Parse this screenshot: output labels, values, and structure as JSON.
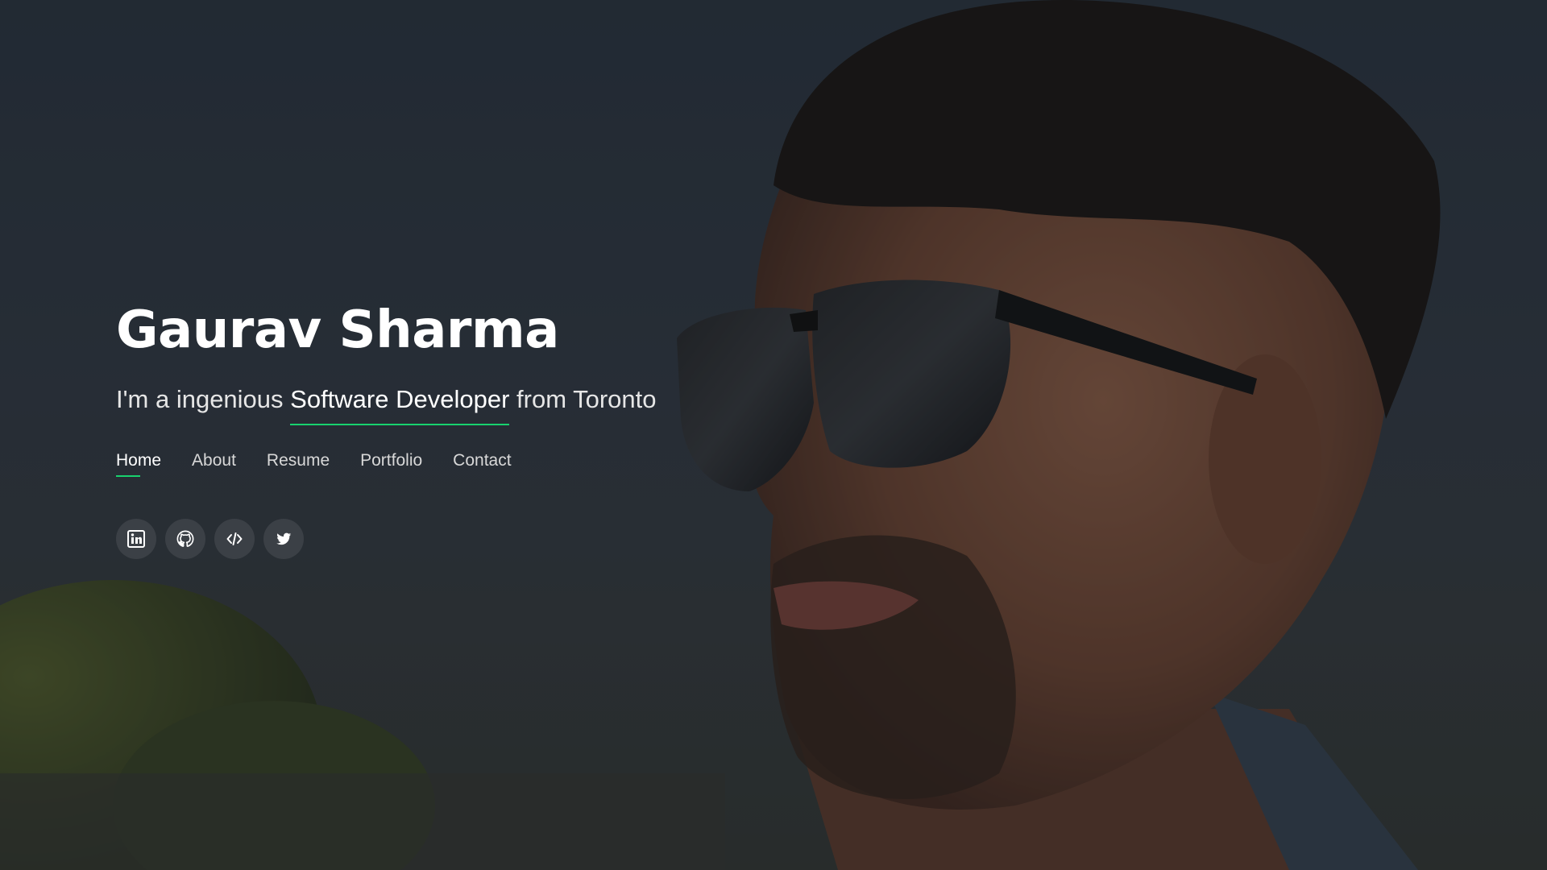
{
  "hero": {
    "name": "Gaurav Sharma",
    "tagline_prefix": "I'm a ingenious ",
    "tagline_role": "Software Developer",
    "tagline_suffix": " from Toronto"
  },
  "nav": {
    "items": [
      {
        "label": "Home",
        "active": true
      },
      {
        "label": "About",
        "active": false
      },
      {
        "label": "Resume",
        "active": false
      },
      {
        "label": "Portfolio",
        "active": false
      },
      {
        "label": "Contact",
        "active": false
      }
    ]
  },
  "social": {
    "items": [
      {
        "icon": "linkedin-icon"
      },
      {
        "icon": "github-icon"
      },
      {
        "icon": "code-icon"
      },
      {
        "icon": "twitter-icon"
      }
    ]
  },
  "colors": {
    "accent": "#18d26e",
    "text": "#ffffff"
  }
}
